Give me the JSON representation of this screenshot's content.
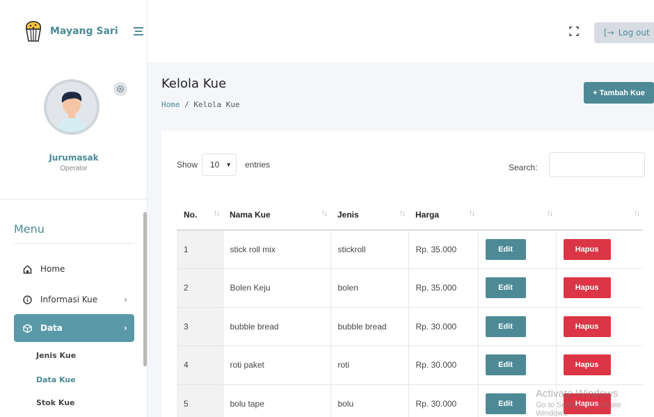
{
  "brand": {
    "name": "Mayang Sari"
  },
  "profile": {
    "name": "Jurumasak",
    "role": "Operator"
  },
  "menu": {
    "title": "Menu",
    "items": [
      {
        "label": "Home",
        "icon": "home-icon"
      },
      {
        "label": "Informasi Kue",
        "icon": "info-icon",
        "chevron": "›"
      },
      {
        "label": "Data",
        "icon": "box-icon",
        "chevron": "›"
      }
    ],
    "submenu": [
      {
        "label": "Jenis Kue",
        "color": "#444444"
      },
      {
        "label": "Data Kue",
        "color": "#4d8a96"
      },
      {
        "label": "Stok Kue",
        "color": "#444444"
      }
    ]
  },
  "topbar": {
    "logout_label": "Log out",
    "logout_icon": "[→"
  },
  "page": {
    "title": "Kelola Kue",
    "breadcrumb_home": "Home",
    "breadcrumb_sep": " / ",
    "breadcrumb_current": "Kelola Kue"
  },
  "add_button": "+ Tambah Kue",
  "table_controls": {
    "show": "Show",
    "length_value": "10",
    "entries": "entries",
    "search": "Search:"
  },
  "table": {
    "headers": [
      "No.",
      "Nama Kue",
      "Jenis",
      "Harga",
      "",
      ""
    ],
    "sort_icon": "↑↓",
    "edit_label": "Edit",
    "delete_label": "Hapus",
    "rows": [
      {
        "no": "1",
        "nama": "stick roll mix",
        "jenis": "stickroll",
        "harga": "Rp. 35.000"
      },
      {
        "no": "2",
        "nama": "Bolen Keju",
        "jenis": "bolen",
        "harga": "Rp. 35.000"
      },
      {
        "no": "3",
        "nama": "bubble bread",
        "jenis": "bubble bread",
        "harga": "Rp. 30.000"
      },
      {
        "no": "4",
        "nama": "roti paket",
        "jenis": "roti",
        "harga": "Rp. 30.000"
      },
      {
        "no": "5",
        "nama": "bolu tape",
        "jenis": "bolu",
        "harga": "Rp. 30.000"
      }
    ]
  },
  "watermark": {
    "line1": "Activate Windows",
    "line2": "Go to Settings to activate Windows."
  },
  "colors": {
    "accent": "#4d8a96",
    "danger": "#dc3545",
    "active_menu": "#5a9aa8"
  }
}
